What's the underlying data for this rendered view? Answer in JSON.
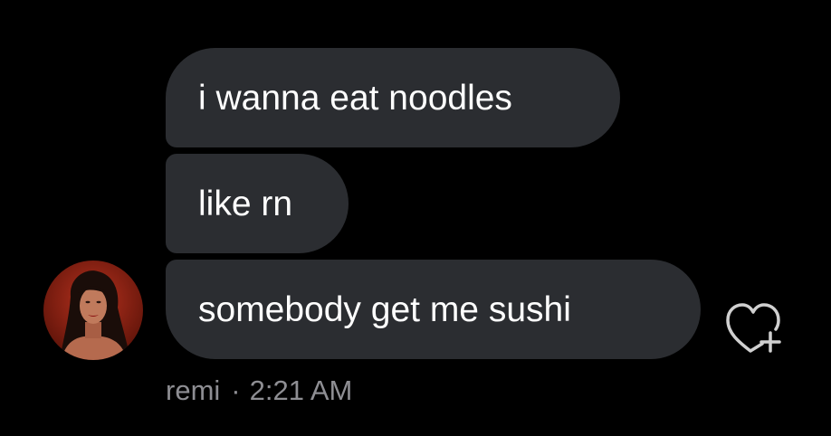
{
  "messages": [
    {
      "text": "i wanna eat noodles"
    },
    {
      "text": "like rn"
    },
    {
      "text": "somebody get me sushi"
    }
  ],
  "sender": {
    "name": "remi",
    "separator": "·",
    "time": "2:21 AM",
    "avatar_icon": "profile-photo"
  },
  "reaction": {
    "icon": "heart-plus-icon"
  },
  "colors": {
    "background": "#000000",
    "bubble": "#2b2d31",
    "text": "#ffffff",
    "meta": "#8e8e93",
    "icon_stroke": "#d0d0d0"
  }
}
